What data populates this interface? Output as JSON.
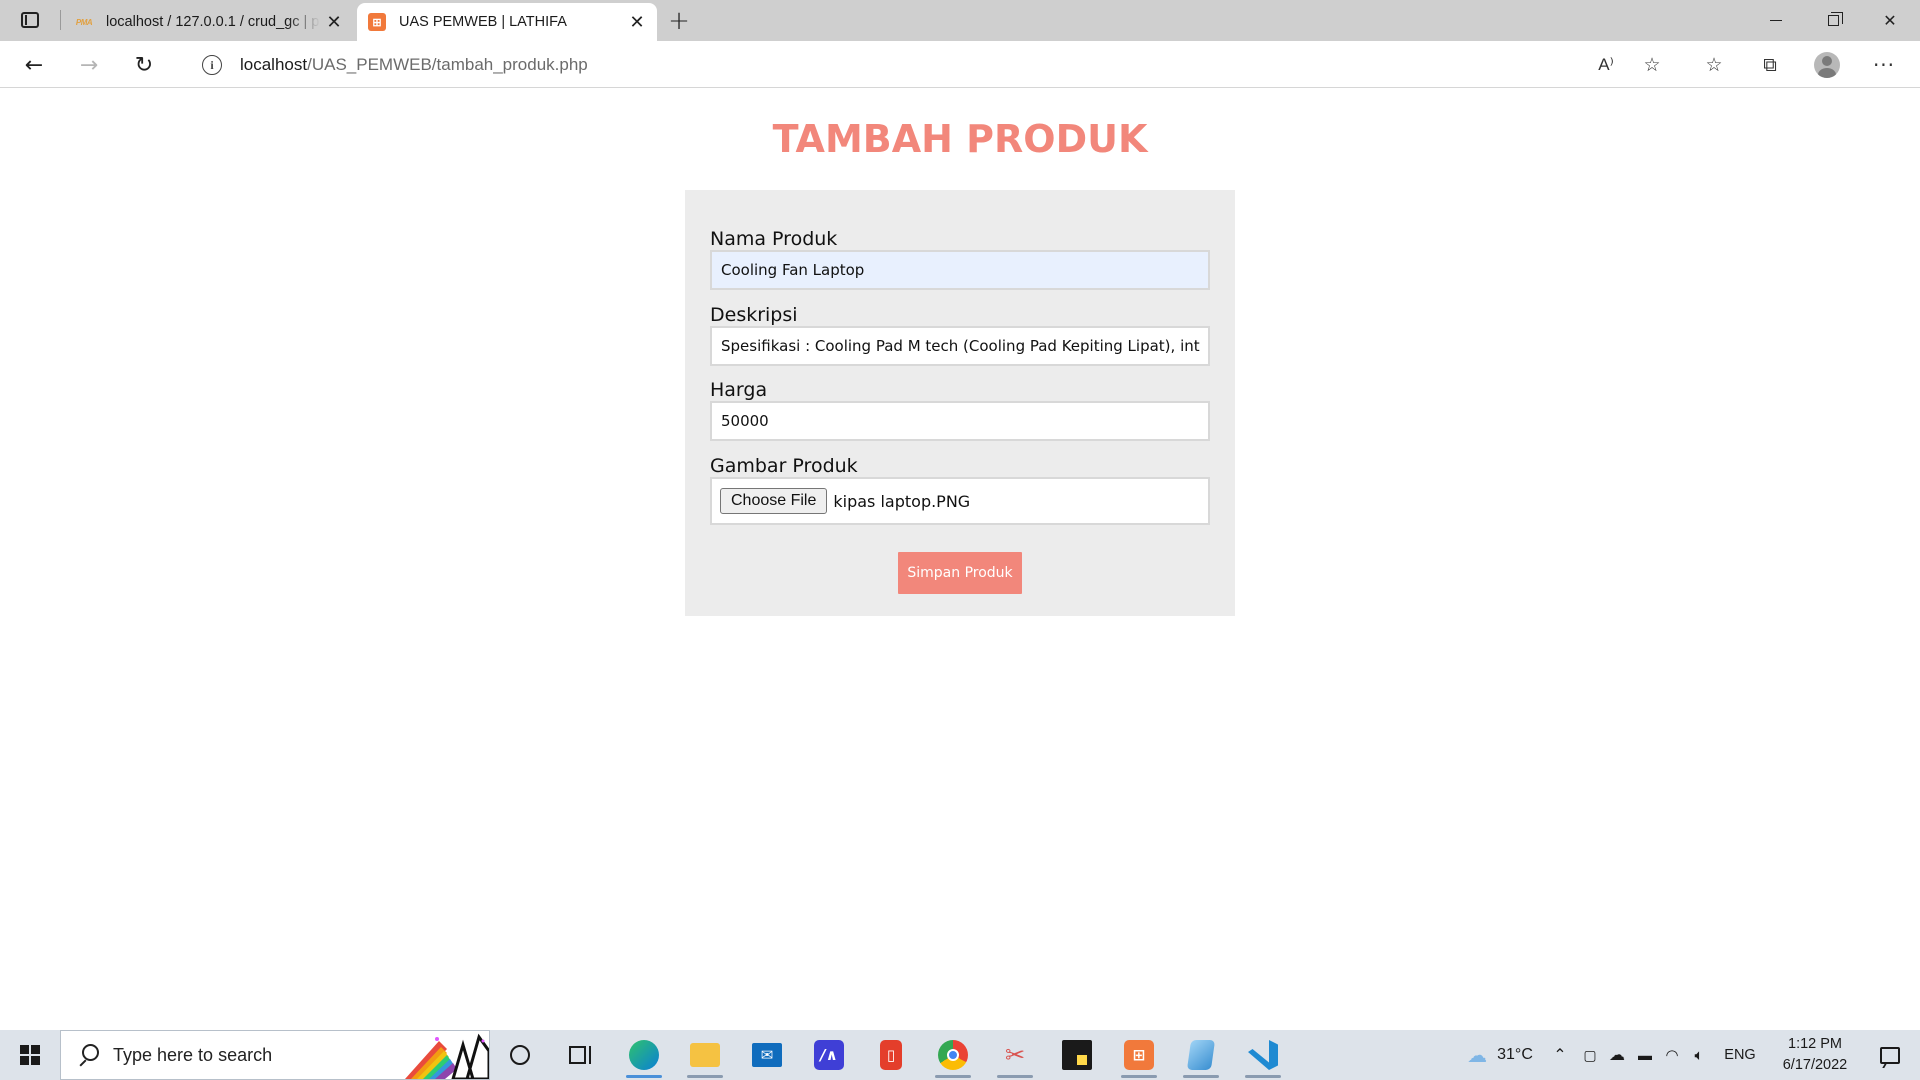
{
  "browser": {
    "tabs": [
      {
        "title": "localhost / 127.0.0.1 / crud_gc | p",
        "favicon": "phpmyadmin-icon",
        "active": false
      },
      {
        "title": "UAS PEMWEB | LATHIFA",
        "favicon": "xampp-icon",
        "active": true
      }
    ],
    "favicon_labels": {
      "pma": "PMA",
      "xampp": "⊞"
    },
    "address": {
      "host": "localhost",
      "path": "/UAS_PEMWEB/tambah_produk.php"
    },
    "read_aloud_label": "A⁾"
  },
  "page": {
    "title": "TAMBAH PRODUK",
    "form": {
      "fields": [
        {
          "label": "Nama Produk",
          "value": "Cooling Fan Laptop",
          "autofilled": true
        },
        {
          "label": "Deskripsi",
          "value": "Spesifikasi : Cooling Pad M tech (Cooling Pad Kepiting Lipat), int",
          "autofilled": false
        },
        {
          "label": "Harga",
          "value": "50000",
          "autofilled": false
        }
      ],
      "file": {
        "label": "Gambar Produk",
        "button_label": "Choose File",
        "file_name": "kipas laptop.PNG"
      },
      "submit_label": "Simpan Produk"
    },
    "colors": {
      "accent": "#f2877b",
      "card_bg": "#ececec"
    }
  },
  "taskbar": {
    "search_placeholder": "Type here to search",
    "apps": [
      "edge-icon",
      "file-explorer-icon",
      "mail-icon",
      "visual-studio-icon",
      "office-icon",
      "chrome-icon",
      "snipping-tool-icon",
      "sticky-notes-icon",
      "xampp-icon",
      "notepad-icon",
      "vscode-icon"
    ],
    "weather": "31°C",
    "language": "ENG",
    "time": "1:12 PM",
    "date": "6/17/2022"
  }
}
